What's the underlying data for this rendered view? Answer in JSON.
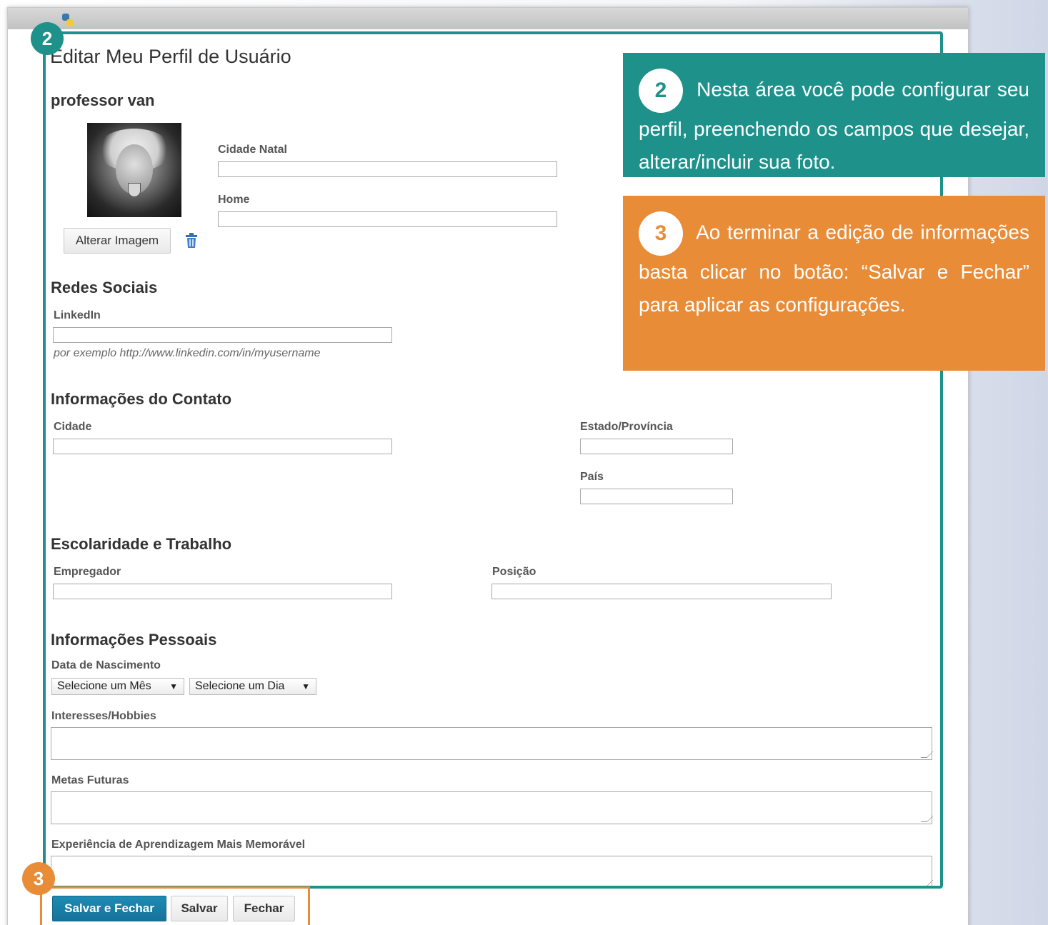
{
  "page": {
    "title": "Editar Meu Perfil de Usuário",
    "username": "professor van"
  },
  "profile_photo": {
    "change_button": "Alterar Imagem",
    "delete_icon": "trash-icon"
  },
  "basic_fields": {
    "hometown_label": "Cidade Natal",
    "hometown_value": "",
    "home_label": "Home",
    "home_value": ""
  },
  "social": {
    "section_title": "Redes Sociais",
    "linkedin_label": "LinkedIn",
    "linkedin_value": "",
    "linkedin_hint": "por exemplo http://www.linkedin.com/in/myusername"
  },
  "contact": {
    "section_title": "Informações do Contato",
    "city_label": "Cidade",
    "state_label": "Estado/Província",
    "country_label": "País"
  },
  "work": {
    "section_title": "Escolaridade e Trabalho",
    "employer_label": "Empregador",
    "position_label": "Posição"
  },
  "personal": {
    "section_title": "Informações Pessoais",
    "birth_label": "Data de Nascimento",
    "month_select": "Selecione um Mês",
    "day_select": "Selecione um Dia",
    "interests_label": "Interesses/Hobbies",
    "goals_label": "Metas Futuras",
    "experience_label": "Experiência de Aprendizagem Mais Memorável"
  },
  "actions": {
    "save_close": "Salvar e Fechar",
    "save": "Salvar",
    "close": "Fechar"
  },
  "annotations": {
    "badge_2": "2",
    "badge_3": "3",
    "callout_2_text": "Nesta área você pode configurar seu perfil, preenchendo os campos que desejar, alterar/incluir sua foto.",
    "callout_3_text": "Ao terminar a edição de informações basta clicar no botão: “Salvar e Fechar” para aplicar as configurações."
  },
  "colors": {
    "teal_accent": "#1f918b",
    "orange_accent": "#e98c38",
    "primary_button": "#16729a"
  }
}
